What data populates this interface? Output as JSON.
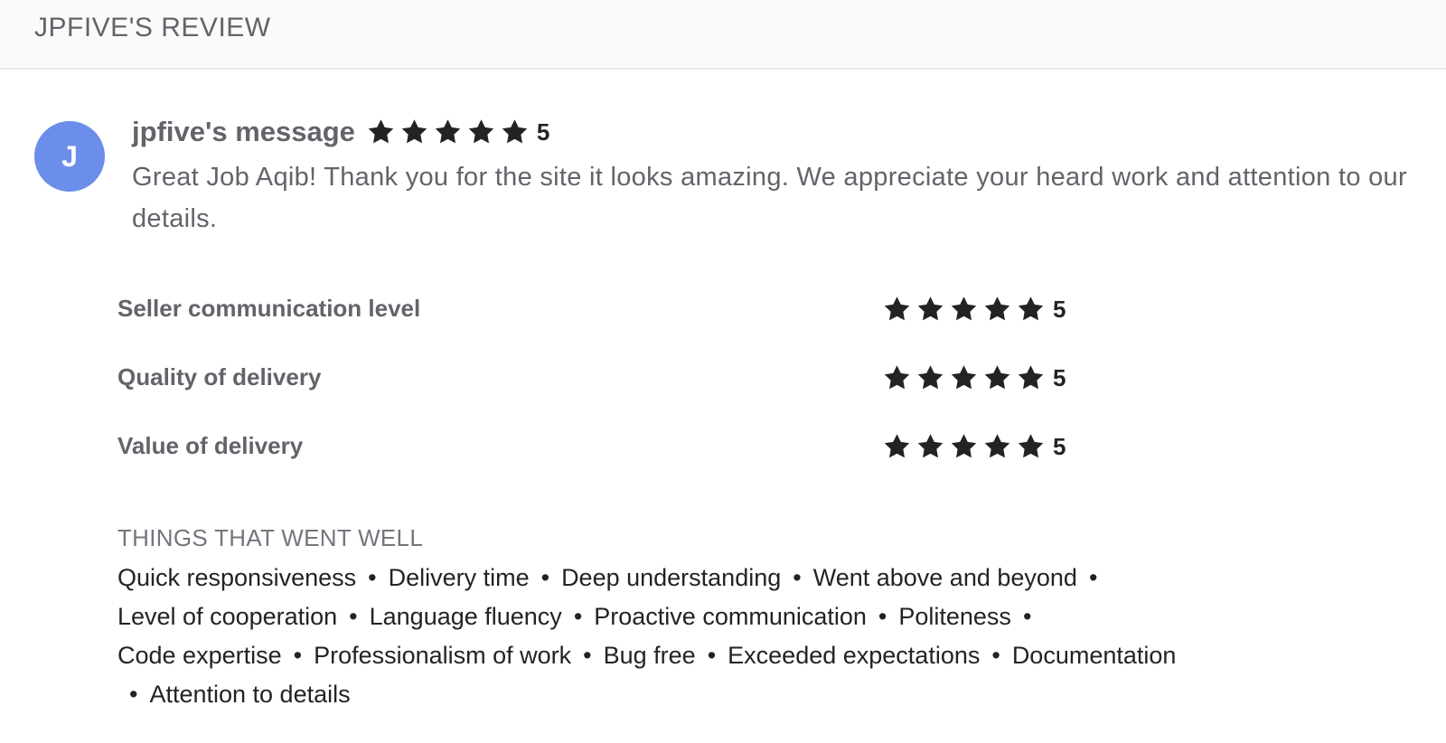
{
  "header": {
    "title": "JPFIVE'S REVIEW"
  },
  "review": {
    "avatar_letter": "J",
    "avatar_color": "#6b8eea",
    "title": "jpfive's message",
    "overall_rating": 5,
    "overall_score": "5",
    "message": "Great Job Aqib! Thank you for the site it looks amazing. We appreciate your heard work and attention to our details."
  },
  "ratings": [
    {
      "label": "Seller communication level",
      "stars": 5,
      "score": "5"
    },
    {
      "label": "Quality of delivery",
      "stars": 5,
      "score": "5"
    },
    {
      "label": "Value of delivery",
      "stars": 5,
      "score": "5"
    }
  ],
  "things_went_well": {
    "title": "THINGS THAT WENT WELL",
    "tags": [
      "Quick responsiveness",
      "Delivery time",
      "Deep understanding",
      "Went above and beyond",
      "Level of cooperation",
      "Language fluency",
      "Proactive communication",
      "Politeness",
      "Code expertise",
      "Professionalism of work",
      "Bug free",
      "Exceeded expectations",
      "Documentation",
      "Attention to details"
    ],
    "separator": "•"
  },
  "colors": {
    "star": "#222325",
    "text_muted": "#62646a",
    "header_bg": "#fafafa"
  }
}
